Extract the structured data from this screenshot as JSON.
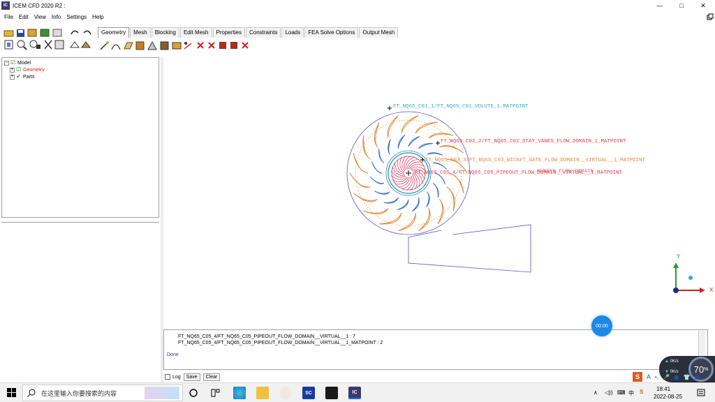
{
  "window": {
    "title": "ICEM CFD 2020 R2 :",
    "app_icon_text": "IC",
    "controls": {
      "minimize": "—",
      "maximize": "□",
      "close": "✕"
    }
  },
  "menu": [
    "File",
    "Edit",
    "View",
    "Info",
    "Settings",
    "Help"
  ],
  "tabs": [
    "Geometry",
    "Mesh",
    "Blocking",
    "Edit Mesh",
    "Properties",
    "Constraints",
    "Loads",
    "FEA Solve Options",
    "Output Mesh"
  ],
  "tree": {
    "root": "Model",
    "children": [
      "Geometry",
      "Parts"
    ]
  },
  "viewport": {
    "labels": [
      "FT_NQ65_C01_1/FT_NQ65_C01_VOLUTE_1_MATPOINT",
      "FT_NQ65_C02_2/FT_NQ65_C02_STAY_VANES_FLOW_DOMAIN_1_MATPOINT",
      "FT_NQ65_C03_3/FT_NQ65_C03_WICKET_GATE_FLOW_DOMAIN__VIRTUAL__1_MATPOINT",
      "FT_NQ65_C05_4/FT_NQ65_C05_PIPEOUT_FLOW_DOMAIN__VIRTUAL__1_MATPOINT",
      "RUNNER_FLOW_DOMAIN"
    ],
    "axis_labels": {
      "y": "Y",
      "x": "X"
    },
    "colors": {
      "volute": "#5a4fcf",
      "stay_vanes": "#e08a3a",
      "wicket_gate": "#3a6fd0",
      "runner": "#e0305a",
      "label_cyan": "#2ab0c0",
      "label_red": "#e04050"
    }
  },
  "console": {
    "lines": [
      "FT_NQ65_C05_4/FT_NQ65_C05_PIPEOUT_FLOW_DOMAIN__VIRTUAL__1 : 7",
      "FT_NQ65_C05_4/FT_NQ65_C05_PIPEOUT_FLOW_DOMAIN__VIRTUAL__1_MATPOINT : 2"
    ],
    "done": "Done",
    "log_label": "Log",
    "save_label": "Save",
    "clear_label": "Clear"
  },
  "overlay": {
    "timer": "00:00",
    "perf_percent": "70",
    "perf_unit": "%",
    "perf_up": "0K/s",
    "perf_down": "0K/s"
  },
  "taskbar": {
    "search_placeholder": "在这里输入你要搜索的内容",
    "time": "18:41",
    "date": "2022-08-25",
    "ime": "A",
    "sc_label": "SC",
    "ic_label": "IC"
  }
}
